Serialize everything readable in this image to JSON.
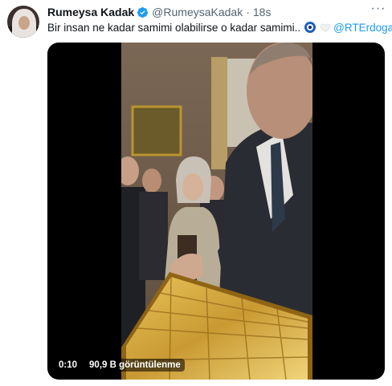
{
  "tweet": {
    "author_name": "Rumeysa Kadak",
    "handle": "@RumeysaKadak",
    "separator": "·",
    "time": "18s",
    "more_label": "···",
    "text_main": "Bir insan ne kadar samimi olabilirse o kadar samimi..",
    "mention": "@RTErdogan"
  },
  "media": {
    "timer": "0:10",
    "views": "90,9 B görüntülenme"
  },
  "icons": {
    "verified": "verified-badge-icon",
    "nazar": "evil-eye-icon",
    "heart": "white-heart-icon"
  },
  "colors": {
    "accent": "#1d9bf0",
    "text": "#0f1419",
    "muted": "#536471"
  }
}
